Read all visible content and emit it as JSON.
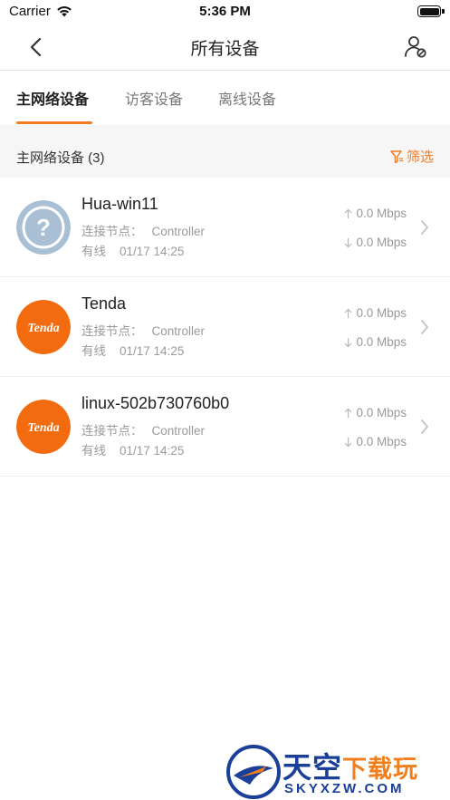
{
  "status_bar": {
    "carrier": "Carrier",
    "time": "5:36 PM"
  },
  "nav": {
    "title": "所有设备",
    "back_icon": "chevron-left-icon",
    "user_icon": "user-settings-icon"
  },
  "tabs": [
    {
      "label": "主网络设备",
      "active": true
    },
    {
      "label": "访客设备",
      "active": false
    },
    {
      "label": "离线设备",
      "active": false
    }
  ],
  "section": {
    "title": "主网络设备 (3)",
    "filter_label": "筛选"
  },
  "devices": [
    {
      "name": "Hua-win11",
      "node_label": "连接节点：",
      "node": "Controller",
      "conn_type": "有线",
      "datetime": "01/17 14:25",
      "up": "0.0 Mbps",
      "down": "0.0 Mbps",
      "avatar": "unknown-device-icon"
    },
    {
      "name": "Tenda",
      "node_label": "连接节点：",
      "node": "Controller",
      "conn_type": "有线",
      "datetime": "01/17 14:25",
      "up": "0.0 Mbps",
      "down": "0.0 Mbps",
      "avatar": "tenda-logo",
      "avatar_text": "Tenda"
    },
    {
      "name": "linux-502b730760b0",
      "node_label": "连接节点：",
      "node": "Controller",
      "conn_type": "有线",
      "datetime": "01/17 14:25",
      "up": "0.0 Mbps",
      "down": "0.0 Mbps",
      "avatar": "tenda-logo",
      "avatar_text": "Tenda"
    }
  ],
  "watermark": {
    "title_main": "天空",
    "title_accent": "下载玩",
    "url": "SKYXZW.COM"
  },
  "colors": {
    "accent": "#f47a20",
    "unknown_avatar": "#a9bfd3",
    "tenda": "#f26b0f",
    "watermark_blue": "#1a3f99"
  }
}
